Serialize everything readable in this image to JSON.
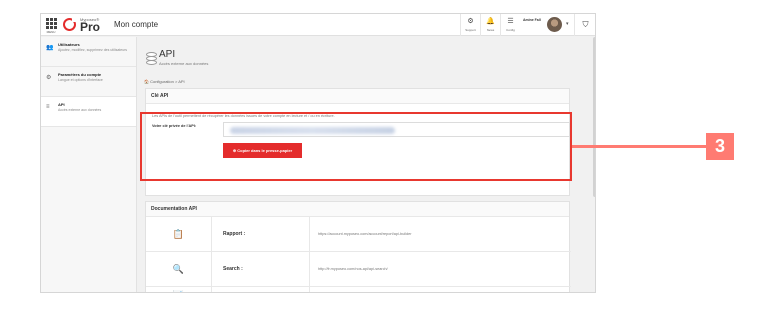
{
  "topbar": {
    "menu_label": "MENU",
    "logo_small": "Myposeo®",
    "logo_text": "Pro",
    "page_title": "Mon compte",
    "icons": [
      {
        "name": "support",
        "glyph": "⚙",
        "label": "Support"
      },
      {
        "name": "news",
        "glyph": "🔔",
        "label": "News"
      },
      {
        "name": "config",
        "glyph": "☰",
        "label": "Config"
      }
    ],
    "user_name": "Amine Fall",
    "caret": "▾",
    "shield": "⛉"
  },
  "sidebar": {
    "items": [
      {
        "icon": "👥",
        "title": "Utilisateurs",
        "subtitle": "Ajoutez, modifiez, supprimez des utilisateurs"
      },
      {
        "icon": "⚙",
        "title": "Paramètres du compte",
        "subtitle": "Langue et options d'interface"
      },
      {
        "icon": "≡",
        "title": "API",
        "subtitle": "Accès externe aux données"
      }
    ]
  },
  "main": {
    "title": "API",
    "subtitle": "Accès externe aux données",
    "breadcrumb": "🏠 Configuration > API",
    "key_card": {
      "header": "Clé API",
      "description": "Les APIs de l'outil permettent de récupérer les données issues de votre compte en lecture et / ou en écriture.",
      "key_label": "Votre clé privée de l'API:",
      "copy_button": "⊕ Copier dans le presse-papier"
    },
    "doc_card": {
      "header": "Documentation API",
      "rows": [
        {
          "icon": "📋",
          "name": "Rapport :",
          "url": "https://account.myposeo.com/account/report/api-builder"
        },
        {
          "icon": "🔍",
          "name": "Search :",
          "url": "http://fr.myposeo.com/nos-api/api-search/"
        },
        {
          "icon": "📊",
          "name": "",
          "url": ""
        }
      ]
    }
  },
  "callout": {
    "number": "3"
  },
  "colors": {
    "accent": "#e42c2c",
    "callout": "#ff7b72"
  }
}
